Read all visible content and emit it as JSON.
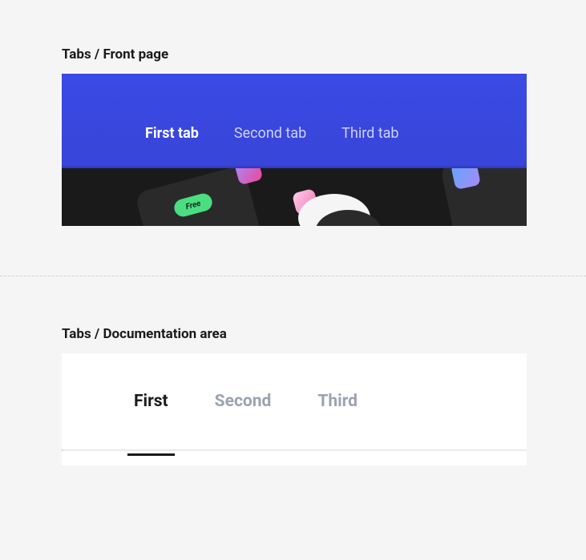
{
  "sections": {
    "front": {
      "title": "Tabs / Front page",
      "tabs": [
        {
          "label": "First tab",
          "active": true
        },
        {
          "label": "Second tab",
          "active": false
        },
        {
          "label": "Third tab",
          "active": false
        }
      ],
      "badge_text": "Free"
    },
    "docs": {
      "title": "Tabs / Documentation area",
      "tabs": [
        {
          "label": "First",
          "active": true
        },
        {
          "label": "Second",
          "active": false
        },
        {
          "label": "Third",
          "active": false
        }
      ]
    }
  }
}
